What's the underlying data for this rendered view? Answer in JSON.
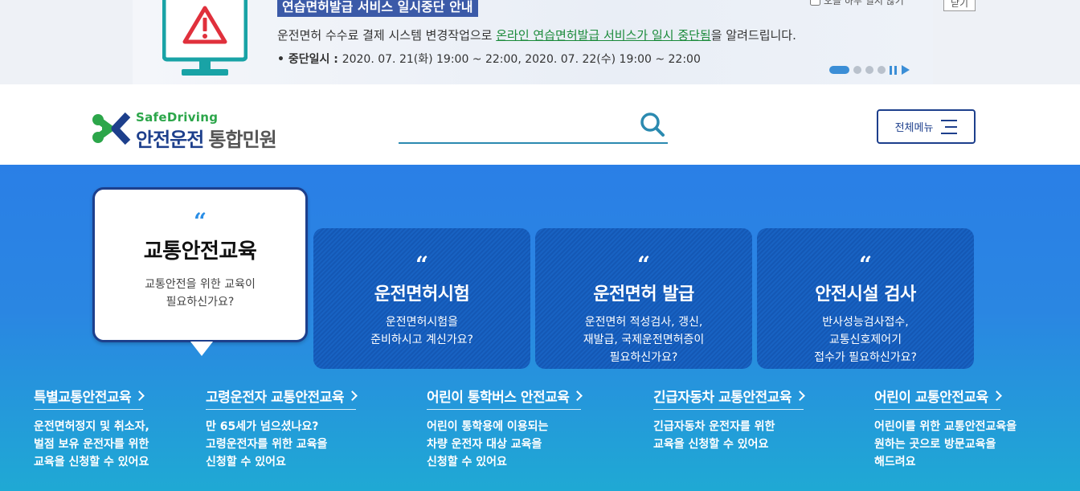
{
  "notice": {
    "title": "연습면허발급 서비스 일시중단 안내",
    "line1_prefix": "운전면허 수수료 결제 시스템 변경작업으로 ",
    "line1_highlight": "온라인 연습면허발급 서비스가 일시 중단됨",
    "line1_suffix": "을 알려드립니다.",
    "line2_label": "• 중단일시 : ",
    "line2_value": "2020. 07. 21(화) 19:00 ~ 22:00,  2020. 07. 22(수) 19:00 ~ 22:00",
    "no_show_label": "오늘 하루 열지 않기",
    "close_label": "닫기",
    "slide_count": 4,
    "active_slide": 1,
    "icon": "warning-monitor-icon"
  },
  "header": {
    "logo_sub": "SafeDriving",
    "logo_main": "안전운전",
    "logo_main_light": "통합민원",
    "search_placeholder": "",
    "menu_label": "전체메뉴"
  },
  "cards": [
    {
      "quote": "“",
      "title": "교통안전교육",
      "desc": [
        "교통안전을 위한 교육이",
        "필요하신가요?"
      ]
    },
    {
      "quote": "“",
      "title": "운전면허시험",
      "desc": [
        "운전면허시험을",
        "준비하시고 계신가요?"
      ]
    },
    {
      "quote": "“",
      "title": "운전면허 발급",
      "desc": [
        "운전면허 적성검사, 갱신,",
        "재발급, 국제운전면허증이",
        "필요하신가요?"
      ]
    },
    {
      "quote": "“",
      "title": "안전시설 검사",
      "desc": [
        "반사성능검사접수,",
        "교통신호제어기",
        "접수가 필요하신가요?"
      ]
    }
  ],
  "edu": [
    {
      "title": "특별교통안전교육",
      "desc": [
        "운전면허정지 및 취소자,",
        "벌점 보유 운전자를 위한",
        "교육을 신청할 수 있어요"
      ]
    },
    {
      "title": "고령운전자 교통안전교육",
      "desc": [
        "만 65세가 넘으셨나요?",
        "고령운전자를 위한 교육을",
        "신청할 수 있어요"
      ]
    },
    {
      "title": "어린이 통학버스 안전교육",
      "desc": [
        "어린이 통학용에 이용되는",
        "차량 운전자 대상 교육을",
        "신청할 수 있어요"
      ]
    },
    {
      "title": "긴급자동차 교통안전교육",
      "desc": [
        "긴급자동차 운전자를 위한",
        "교육을 신청할 수 있어요"
      ]
    },
    {
      "title": "어린이 교통안전교육",
      "desc": [
        "어린이를 위한 교통안전교육을",
        "원하는 곳으로 방문교육을",
        "해드려요"
      ]
    }
  ],
  "colors": {
    "brand_navy": "#1d3f8c",
    "brand_green": "#2ca64a",
    "hero_blue": "#2a7fe6",
    "hero_teal": "#1fa9d4",
    "card_blue": "#1458b5",
    "notice_title_bg": "#3b5aa8",
    "highlight_green": "#1a8a3a"
  }
}
